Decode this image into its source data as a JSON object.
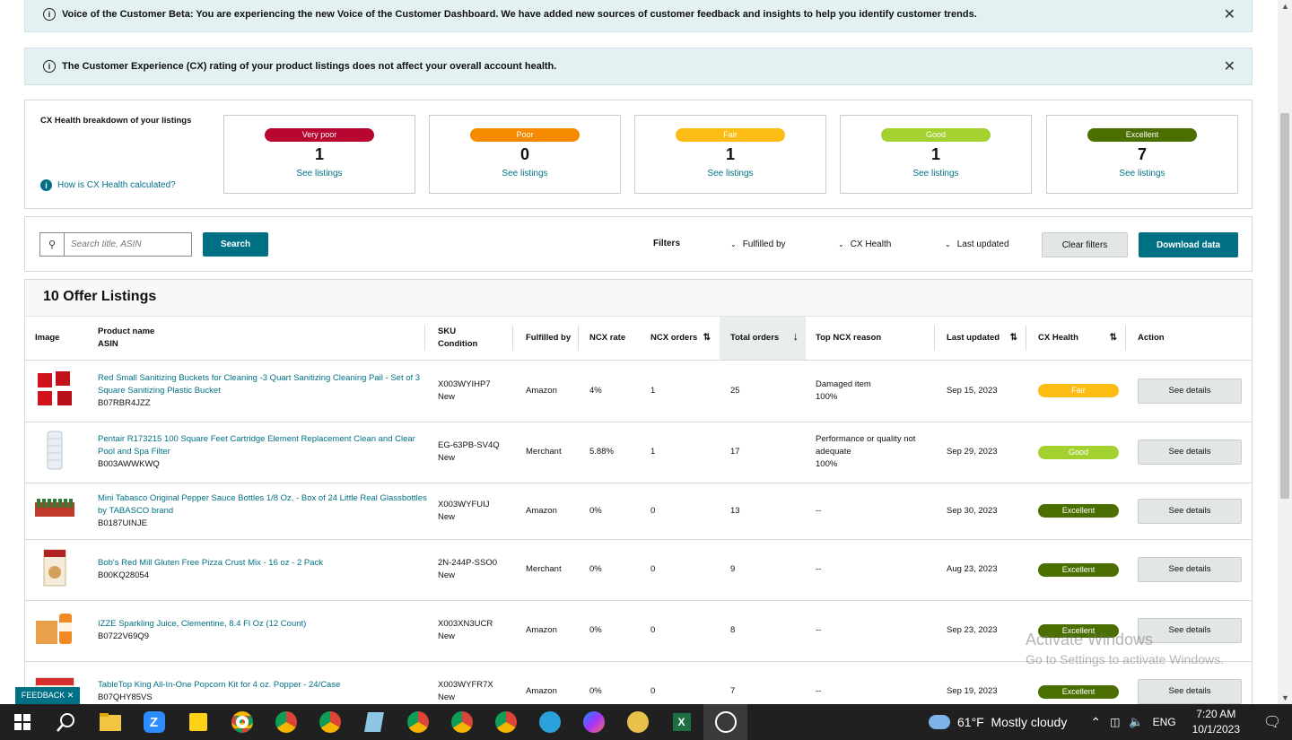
{
  "banners": [
    {
      "text": "Voice of the Customer Beta: You are experiencing the new Voice of the Customer Dashboard. We have added new sources of customer feedback and insights to help you identify customer trends.",
      "close": "✕"
    },
    {
      "text": "The Customer Experience (CX) rating of your product listings does not affect your overall account health.",
      "close": "✕"
    }
  ],
  "health": {
    "title": "CX Health breakdown of your listings",
    "how_link": "How is CX Health calculated?",
    "cards": [
      {
        "label": "Very poor",
        "count": "1",
        "link": "See listings",
        "color": "#b7062f"
      },
      {
        "label": "Poor",
        "count": "0",
        "link": "See listings",
        "color": "#f58a00"
      },
      {
        "label": "Fair",
        "count": "1",
        "link": "See listings",
        "color": "#fcbc13"
      },
      {
        "label": "Good",
        "count": "1",
        "link": "See listings",
        "color": "#a3d130"
      },
      {
        "label": "Excellent",
        "count": "7",
        "link": "See listings",
        "color": "#4a6e00"
      }
    ]
  },
  "filters": {
    "search_placeholder": "Search title, ASIN",
    "search_button": "Search",
    "filters_label": "Filters",
    "fulfilled_by": "Fulfilled by",
    "cx_health": "CX Health",
    "last_updated": "Last updated",
    "clear": "Clear filters",
    "download": "Download data"
  },
  "listings": {
    "title": "10 Offer Listings",
    "columns": {
      "image": "Image",
      "product": "Product name",
      "asin": "ASIN",
      "sku": "SKU",
      "condition": "Condition",
      "fulfilled": "Fulfilled by",
      "ncx_rate": "NCX rate",
      "ncx_orders": "NCX orders",
      "total_orders": "Total orders",
      "top_reason": "Top NCX reason",
      "last_updated": "Last updated",
      "cx_health": "CX Health",
      "action": "Action"
    },
    "rows": [
      {
        "name": "Red Small Sanitizing Buckets for Cleaning -3 Quart Sanitizing Cleaning Pail - Set of 3 Square Sanitizing Plastic Bucket",
        "asin": "B07RBR4JZZ",
        "sku": "X003WYIHP7",
        "cond": "New",
        "fulfilled": "Amazon",
        "rate": "4%",
        "ncx": "1",
        "total": "25",
        "reason": "Damaged item",
        "reason_pct": "100%",
        "updated": "Sep 15, 2023",
        "health": "Fair",
        "health_color": "#fcbc13",
        "action": "See details"
      },
      {
        "name": "Pentair R173215 100 Square Feet Cartridge Element Replacement Clean and Clear Pool and Spa Filter",
        "asin": "B003AWWKWQ",
        "sku": "EG-63PB-SV4Q",
        "cond": "New",
        "fulfilled": "Merchant",
        "rate": "5.88%",
        "ncx": "1",
        "total": "17",
        "reason": "Performance or quality not adequate",
        "reason_pct": "100%",
        "updated": "Sep 29, 2023",
        "health": "Good",
        "health_color": "#a3d130",
        "action": "See details"
      },
      {
        "name": "Mini Tabasco Original Pepper Sauce Bottles 1/8 Oz. - Box of 24 Little Real Glassbottles by TABASCO brand",
        "asin": "B0187UINJE",
        "sku": "X003WYFUIJ",
        "cond": "New",
        "fulfilled": "Amazon",
        "rate": "0%",
        "ncx": "0",
        "total": "13",
        "reason": "--",
        "reason_pct": "",
        "updated": "Sep 30, 2023",
        "health": "Excellent",
        "health_color": "#4a6e00",
        "action": "See details"
      },
      {
        "name": "Bob's Red Mill Gluten Free Pizza Crust Mix - 16 oz - 2 Pack",
        "asin": "B00KQ28054",
        "sku": "2N-244P-SSO0",
        "cond": "New",
        "fulfilled": "Merchant",
        "rate": "0%",
        "ncx": "0",
        "total": "9",
        "reason": "--",
        "reason_pct": "",
        "updated": "Aug 23, 2023",
        "health": "Excellent",
        "health_color": "#4a6e00",
        "action": "See details"
      },
      {
        "name": "IZZE Sparkling Juice, Clementine, 8.4 Fl Oz (12 Count)",
        "asin": "B0722V69Q9",
        "sku": "X003XN3UCR",
        "cond": "New",
        "fulfilled": "Amazon",
        "rate": "0%",
        "ncx": "0",
        "total": "8",
        "reason": "--",
        "reason_pct": "",
        "updated": "Sep 23, 2023",
        "health": "Excellent",
        "health_color": "#4a6e00",
        "action": "See details"
      },
      {
        "name": "TableTop King All-In-One Popcorn Kit for 4 oz. Popper - 24/Case",
        "asin": "B07QHY85VS",
        "sku": "X003WYFR7X",
        "cond": "New",
        "fulfilled": "Amazon",
        "rate": "0%",
        "ncx": "0",
        "total": "7",
        "reason": "--",
        "reason_pct": "",
        "updated": "Sep 19, 2023",
        "health": "Excellent",
        "health_color": "#4a6e00",
        "action": "See details"
      }
    ]
  },
  "feedback": "FEEDBACK ✕",
  "watermark": {
    "line1": "Activate Windows",
    "line2": "Go to Settings to activate Windows."
  },
  "taskbar": {
    "icons": [
      "windows-start-icon",
      "search-icon",
      "file-explorer-icon",
      "zoom-icon",
      "sticky-notes-icon",
      "chrome-icon",
      "chrome-icon",
      "chrome-icon",
      "notepad-icon",
      "chrome-icon",
      "chrome-icon",
      "chrome-icon",
      "telegram-icon",
      "messenger-icon",
      "emoji-app-icon",
      "excel-icon",
      "photos-icon"
    ],
    "weather": "61°F  Mostly cloudy",
    "lang": "ENG",
    "time": "7:20 AM",
    "date": "10/1/2023"
  }
}
